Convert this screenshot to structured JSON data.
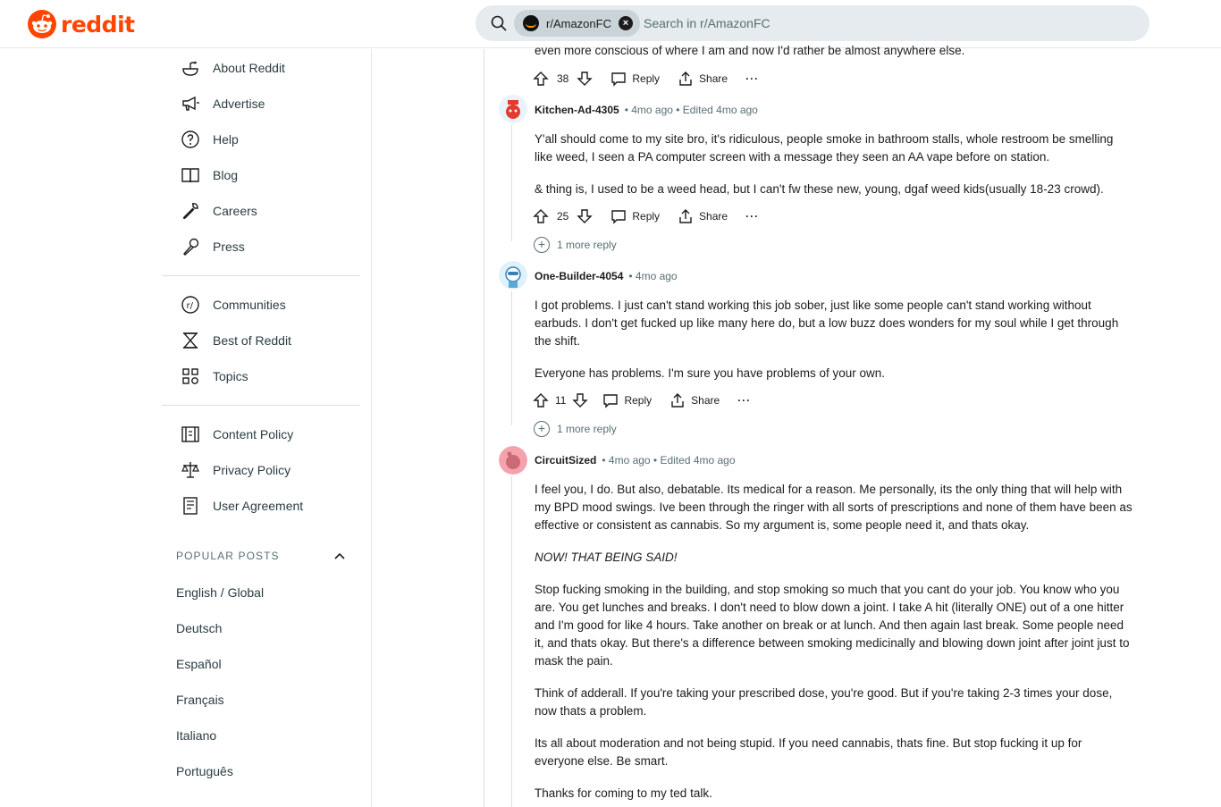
{
  "header": {
    "logo_text": "reddit",
    "search_chip": "r/AmazonFC",
    "search_placeholder": "Search in r/AmazonFC",
    "brand_color": "#ff4500"
  },
  "sidebar": {
    "resources": [
      {
        "label": "About Reddit",
        "icon": "about-icon"
      },
      {
        "label": "Advertise",
        "icon": "megaphone-icon"
      },
      {
        "label": "Help",
        "icon": "help-icon"
      },
      {
        "label": "Blog",
        "icon": "book-icon"
      },
      {
        "label": "Careers",
        "icon": "wrench-icon"
      },
      {
        "label": "Press",
        "icon": "microphone-icon"
      }
    ],
    "browse": [
      {
        "label": "Communities",
        "icon": "communities-icon"
      },
      {
        "label": "Best of Reddit",
        "icon": "hourglass-icon"
      },
      {
        "label": "Topics",
        "icon": "topics-icon"
      }
    ],
    "policies": [
      {
        "label": "Content Policy",
        "icon": "content-policy-icon"
      },
      {
        "label": "Privacy Policy",
        "icon": "scale-icon"
      },
      {
        "label": "User Agreement",
        "icon": "agreement-icon"
      }
    ],
    "popular_posts_heading": "POPULAR POSTS",
    "languages": [
      "English / Global",
      "Deutsch",
      "Español",
      "Français",
      "Italiano",
      "Português"
    ]
  },
  "thread": {
    "partial_text": "even more conscious of where I am and now I'd rather be almost anywhere else.",
    "partial_votes": "38",
    "reply_label": "Reply",
    "share_label": "Share",
    "comments": [
      {
        "author": "Kitchen-Ad-4305",
        "meta": "• 4mo ago • Edited 4mo ago",
        "paragraphs": [
          "Y'all should come to my site bro, it's ridiculous, people smoke in bathroom stalls, whole restroom be smelling like weed, I seen a PA computer screen with a message they seen an AA vape before on station.",
          "& thing is, I used to be a weed head, but I can't fw these new, young, dgaf weed kids(usually 18-23 crowd)."
        ],
        "votes": "25",
        "more_replies": "1 more reply"
      },
      {
        "author": "One-Builder-4054",
        "meta": "• 4mo ago",
        "paragraphs": [
          "I got problems. I just can't stand working this job sober, just like some people can't stand working without earbuds. I don't get fucked up like many here do, but a low buzz does wonders for my soul while I get through the shift.",
          "Everyone has problems. I'm sure you have problems of your own."
        ],
        "votes": "11",
        "more_replies": "1 more reply"
      },
      {
        "author": "CircuitSized",
        "meta": "• 4mo ago • Edited 4mo ago",
        "paragraphs": [
          "I feel you, I do. But also, debatable. Its medical for a reason. Me personally, its the only thing that will help with my BPD mood swings. Ive been through the ringer with all sorts of prescriptions and none of them have been as effective or consistent as cannabis. So my argument is, some people need it, and thats okay.",
          "NOW! THAT BEING SAID!",
          "Stop fucking smoking in the building, and stop smoking so much that you cant do your job. You know who you are. You get lunches and breaks. I don't need to blow down a joint. I take A hit (literally ONE) out of a one hitter and I'm good for like 4 hours. Take another on break or at lunch. And then again last break. Some people need it, and thats okay. But there's a difference between smoking medicinally and blowing down joint after joint just to mask the pain.",
          "Think of adderall. If you're taking your prescribed dose, you're good. But if you're taking 2-3 times your dose, now thats a problem.",
          "Its all about moderation and not being stupid. If you need cannabis, thats fine. But stop fucking it up for everyone else. Be smart.",
          "Thanks for coming to my ted talk."
        ]
      }
    ]
  }
}
